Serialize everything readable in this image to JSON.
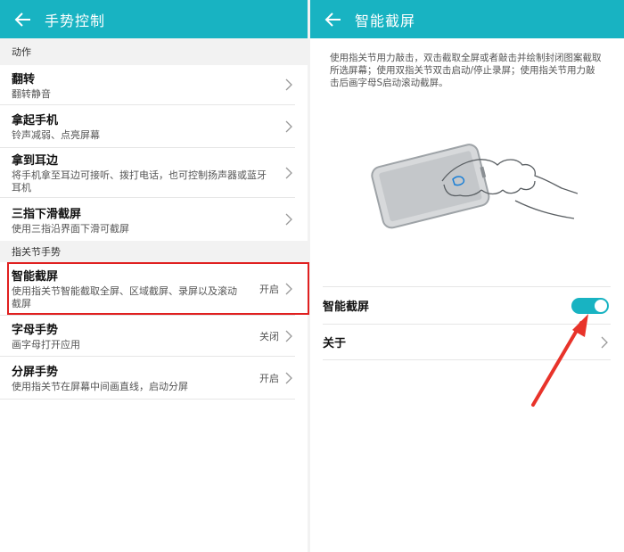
{
  "left": {
    "title": "手势控制",
    "sections": [
      {
        "label": "动作",
        "items": [
          {
            "title": "翻转",
            "subtitle": "翻转静音"
          },
          {
            "title": "拿起手机",
            "subtitle": "铃声减弱、点亮屏幕"
          },
          {
            "title": "拿到耳边",
            "subtitle": "将手机拿至耳边可接听、拨打电话，也可控制扬声器或蓝牙耳机"
          },
          {
            "title": "三指下滑截屏",
            "subtitle": "使用三指沿界面下滑可截屏"
          }
        ]
      },
      {
        "label": "指关节手势",
        "items": [
          {
            "title": "智能截屏",
            "subtitle": "使用指关节智能截取全屏、区域截屏、录屏以及滚动截屏",
            "value": "开启"
          },
          {
            "title": "字母手势",
            "subtitle": "画字母打开应用",
            "value": "关闭"
          },
          {
            "title": "分屏手势",
            "subtitle": "使用指关节在屏幕中间画直线，启动分屏",
            "value": "开启"
          }
        ]
      }
    ]
  },
  "right": {
    "title": "智能截屏",
    "description": "使用指关节用力敲击，双击截取全屏或者敲击并绘制封闭图案截取所选屏幕；使用双指关节双击启动/停止录屏；使用指关节用力敲击后画字母S启动滚动截屏。",
    "toggle_label": "智能截屏",
    "toggle_on": true,
    "about_label": "关于"
  },
  "colors": {
    "accent": "#18b3c2",
    "highlight": "#e02020"
  },
  "icons": {
    "back": "arrow-left-icon",
    "chevron": "chevron-right-icon",
    "annotation": "red-arrow"
  }
}
